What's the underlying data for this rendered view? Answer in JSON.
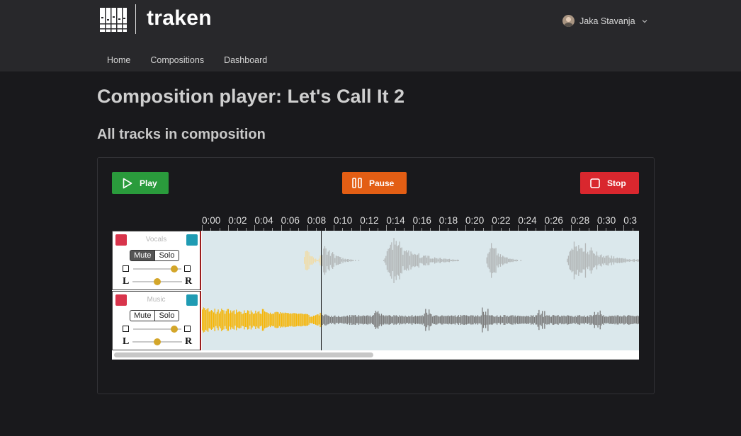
{
  "header": {
    "brand": "traken",
    "user_name": "Jaka Stavanja",
    "nav": [
      "Home",
      "Compositions",
      "Dashboard"
    ]
  },
  "page": {
    "title": "Composition player: Let's Call It 2",
    "subtitle": "All tracks in composition"
  },
  "controls": {
    "play": "Play",
    "pause": "Pause",
    "stop": "Stop"
  },
  "timeline": {
    "labels": [
      "0:00",
      "0:02",
      "0:04",
      "0:06",
      "0:08",
      "0:10",
      "0:12",
      "0:14",
      "0:16",
      "0:18",
      "0:20",
      "0:22",
      "0:24",
      "0:26",
      "0:28",
      "0:30",
      "0:3"
    ]
  },
  "tracks": [
    {
      "name": "Vocals",
      "mute": "Mute",
      "solo": "Solo",
      "mute_active": true,
      "volume": 0.85,
      "pan": 0.5,
      "pan_left": "L",
      "pan_right": "R"
    },
    {
      "name": "Music",
      "mute": "Mute",
      "solo": "Solo",
      "mute_active": false,
      "volume": 0.85,
      "pan": 0.5,
      "pan_left": "L",
      "pan_right": "R"
    }
  ],
  "colors": {
    "play": "#2a9b3c",
    "pause": "#e35e14",
    "stop": "#d9272e",
    "wave_played": "#f5b60a",
    "wave_played_muted": "#efdcaa",
    "wave_unplayed": "#7d7d7d",
    "wave_unplayed_muted": "#b5b9ba",
    "track_bg": "#dbe8ec",
    "knob": "#d3a62a"
  },
  "playback": {
    "position_label": "0:08"
  }
}
